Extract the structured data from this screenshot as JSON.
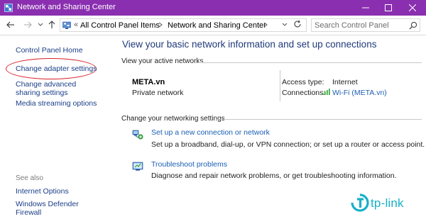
{
  "window": {
    "title": "Network and Sharing Center",
    "accent": "#8a2fb0"
  },
  "address": {
    "crumbs": [
      "All Control Panel Items",
      "Network and Sharing Center"
    ],
    "overflow": "«",
    "search_placeholder": "Search Control Panel"
  },
  "sidebar": {
    "home": "Control Panel Home",
    "adapter": "Change adapter settings",
    "advanced": "Change advanced sharing settings",
    "media": "Media streaming options",
    "see_also": "See also",
    "internet_options": "Internet Options",
    "firewall": "Windows Defender Firewall"
  },
  "main": {
    "heading": "View your basic network information and set up connections",
    "active_label": "View your active networks",
    "network": {
      "name": "META.vn",
      "type": "Private network",
      "access_label": "Access type:",
      "access_value": "Internet",
      "connections_label": "Connections:",
      "connection_value": "Wi-Fi (META.vn)"
    },
    "settings_label": "Change your networking settings",
    "tasks": [
      {
        "link": "Set up a new connection or network",
        "desc": "Set up a broadband, dial-up, or VPN connection; or set up a router or access point.",
        "icon": "network-setup-icon"
      },
      {
        "link": "Troubleshoot problems",
        "desc": "Diagnose and repair network problems, or get troubleshooting information.",
        "icon": "troubleshoot-icon"
      }
    ]
  },
  "watermark": {
    "brand": "tp-link",
    "color": "#18b0c8"
  },
  "highlight_color": "#d72027"
}
